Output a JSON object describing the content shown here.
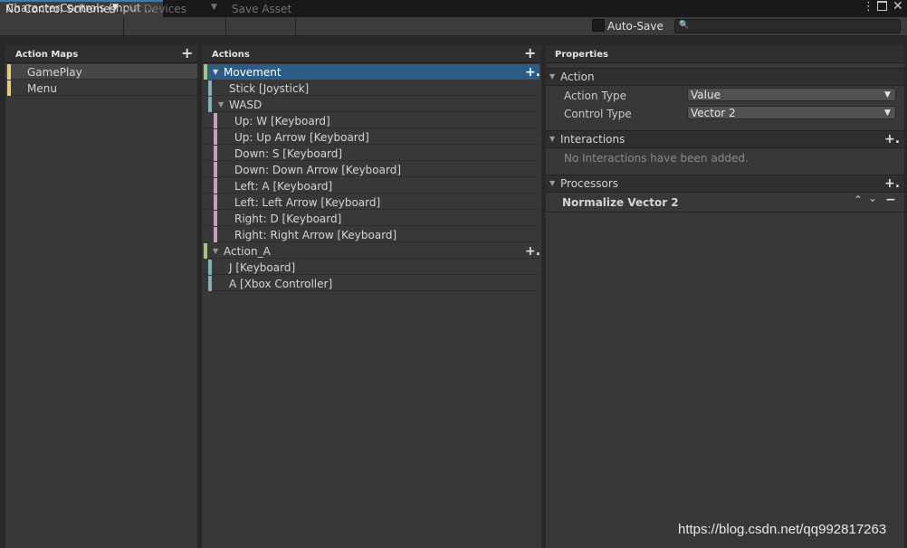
{
  "window": {
    "tab_title": "CharacterControls (Input ...",
    "menu_icon": "kebab-menu-icon",
    "maximize_icon": "maximize-icon",
    "close_icon": "close-icon",
    "menu_glyph": "⋮",
    "close_glyph": "✕"
  },
  "toolbar": {
    "control_scheme": "No Control Schemes",
    "devices": "All Devices",
    "save_asset": "Save Asset",
    "auto_save_label": "Auto-Save",
    "auto_save_checked": false,
    "search_placeholder": "",
    "search_icon_glyph": "🔍",
    "dropdown_glyph": "▼"
  },
  "action_maps": {
    "header": "Action Maps",
    "add_glyph": "+",
    "items": [
      {
        "label": "GamePlay",
        "selected": true
      },
      {
        "label": "Menu",
        "selected": false
      }
    ]
  },
  "actions": {
    "header": "Actions",
    "add_glyph": "+",
    "add_binding_glyph": "+.",
    "expand_glyph": "▼",
    "rows": [
      {
        "label": "Movement",
        "kind": "action",
        "selected": true
      },
      {
        "label": "Stick [Joystick]",
        "kind": "binding"
      },
      {
        "label": "WASD",
        "kind": "composite"
      },
      {
        "label": "Up: W [Keyboard]",
        "kind": "part"
      },
      {
        "label": "Up: Up Arrow [Keyboard]",
        "kind": "part"
      },
      {
        "label": "Down: S [Keyboard]",
        "kind": "part"
      },
      {
        "label": "Down: Down Arrow [Keyboard]",
        "kind": "part"
      },
      {
        "label": "Left: A [Keyboard]",
        "kind": "part"
      },
      {
        "label": "Left: Left Arrow [Keyboard]",
        "kind": "part"
      },
      {
        "label": "Right: D [Keyboard]",
        "kind": "part"
      },
      {
        "label": "Right: Right Arrow [Keyboard]",
        "kind": "part"
      },
      {
        "label": "Action_A",
        "kind": "action",
        "selected": false
      },
      {
        "label": "J [Keyboard]",
        "kind": "binding"
      },
      {
        "label": "A [Xbox Controller]",
        "kind": "binding"
      }
    ]
  },
  "properties": {
    "header": "Properties",
    "action_section": "Action",
    "action_type_label": "Action Type",
    "action_type_value": "Value",
    "control_type_label": "Control Type",
    "control_type_value": "Vector 2",
    "interactions_section": "Interactions",
    "interactions_empty": "No Interactions have been added.",
    "processors_section": "Processors",
    "processor_name": "Normalize Vector 2",
    "up_glyph": "⌃",
    "down_glyph": "⌄",
    "remove_glyph": "−",
    "add_glyph": "+."
  },
  "watermark": "https://blog.csdn.net/qq992817263",
  "colors": {
    "selection_blue": "#2c5d87",
    "map_bar_yellow": "#e7cc7a",
    "binding_bar_teal": "#7fb1bd",
    "part_bar_pink": "#c8a0b9",
    "action_bar_green": "#9fc67d"
  }
}
